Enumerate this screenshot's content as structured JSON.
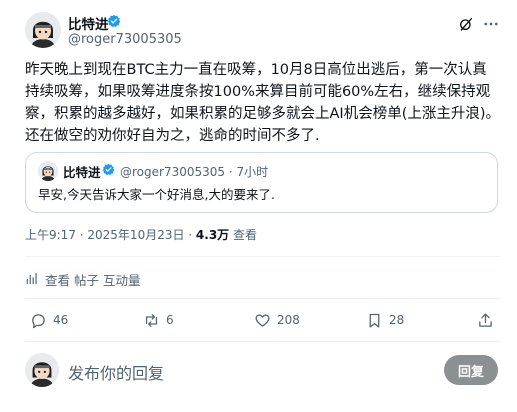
{
  "post": {
    "author_name": "比特进",
    "handle": "@roger73005305",
    "text": "昨天晚上到现在BTC主力一直在吸筹，10月8日高位出逃后，第一次认真持续吸筹，如果吸筹进度条按100%来算目前可能60%左右，继续保持观察，积累的越多越好，如果积累的足够多就会上AI机会榜单(上涨主升浪)。还在做空的劝你好自为之，逃命的时间不多了."
  },
  "quote": {
    "author_name": "比特进",
    "handle_time": "@roger73005305 · 7小时",
    "text": "早安,今天告诉大家一个好消息,大的要来了."
  },
  "meta": {
    "timestamp": "上午9:17 · 2025年10月23日 · ",
    "views_count": "4.3万",
    "views_label": " 查看"
  },
  "analytics": {
    "label": "查看 帖子 互动量"
  },
  "actions": {
    "replies": "46",
    "reposts": "6",
    "likes": "208",
    "bookmarks": "28"
  },
  "reply_box": {
    "placeholder": "发布你的回复",
    "button_label": "回复"
  },
  "colors": {
    "text": "#0f1419",
    "secondary": "#536471",
    "verified": "#1d9bf0",
    "border": "#cfd9de",
    "reply_button": "#8b9093"
  },
  "icons": [
    "verified-badge-icon",
    "grok-icon",
    "more-icon",
    "analytics-icon",
    "reply-icon",
    "repost-icon",
    "like-icon",
    "bookmark-icon",
    "share-icon"
  ]
}
